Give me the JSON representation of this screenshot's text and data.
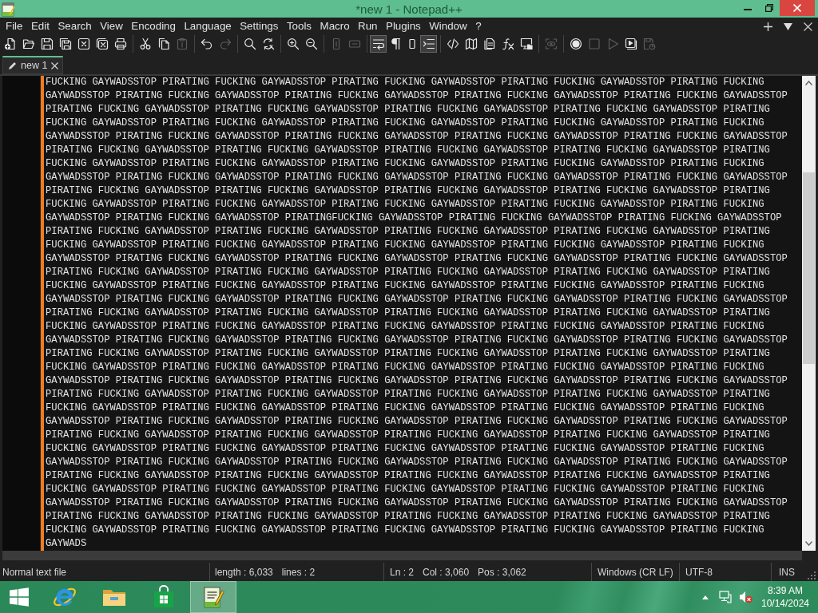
{
  "window": {
    "title": "*new 1 - Notepad++"
  },
  "menu": [
    "File",
    "Edit",
    "Search",
    "View",
    "Encoding",
    "Language",
    "Settings",
    "Tools",
    "Macro",
    "Run",
    "Plugins",
    "Window",
    "?"
  ],
  "toolbar": [
    [
      {
        "kind": "new",
        "disabled": false,
        "pressed": false
      },
      {
        "kind": "open",
        "disabled": false,
        "pressed": false
      },
      {
        "kind": "save",
        "disabled": false,
        "pressed": false
      },
      {
        "kind": "saveall",
        "disabled": false,
        "pressed": false
      },
      {
        "kind": "close",
        "disabled": false,
        "pressed": false
      },
      {
        "kind": "closeall",
        "disabled": false,
        "pressed": false
      },
      {
        "kind": "print",
        "disabled": false,
        "pressed": false
      }
    ],
    [
      {
        "kind": "cut",
        "disabled": false,
        "pressed": false
      },
      {
        "kind": "copy",
        "disabled": false,
        "pressed": false
      },
      {
        "kind": "paste",
        "disabled": true,
        "pressed": false
      }
    ],
    [
      {
        "kind": "undo",
        "disabled": false,
        "pressed": false
      },
      {
        "kind": "redo",
        "disabled": true,
        "pressed": false
      }
    ],
    [
      {
        "kind": "find",
        "disabled": false,
        "pressed": false
      },
      {
        "kind": "replace",
        "disabled": false,
        "pressed": false
      }
    ],
    [
      {
        "kind": "zoomin",
        "disabled": false,
        "pressed": false
      },
      {
        "kind": "zoomout",
        "disabled": false,
        "pressed": false
      }
    ],
    [
      {
        "kind": "syncv",
        "disabled": true,
        "pressed": false
      },
      {
        "kind": "synch",
        "disabled": true,
        "pressed": false
      }
    ],
    [
      {
        "kind": "wrap",
        "disabled": false,
        "pressed": true
      },
      {
        "kind": "allchars",
        "disabled": false,
        "pressed": false
      },
      {
        "kind": "panel",
        "disabled": false,
        "pressed": false
      },
      {
        "kind": "indentguide",
        "disabled": false,
        "pressed": true
      }
    ],
    [
      {
        "kind": "udl",
        "disabled": false,
        "pressed": false
      },
      {
        "kind": "docmap",
        "disabled": false,
        "pressed": false
      },
      {
        "kind": "doclist",
        "disabled": false,
        "pressed": false
      },
      {
        "kind": "funclist",
        "disabled": false,
        "pressed": false
      },
      {
        "kind": "folderws",
        "disabled": false,
        "pressed": false
      }
    ],
    [
      {
        "kind": "monitor",
        "disabled": true,
        "pressed": false
      }
    ],
    [
      {
        "kind": "record",
        "disabled": false,
        "pressed": false
      },
      {
        "kind": "stop",
        "disabled": true,
        "pressed": false
      },
      {
        "kind": "play",
        "disabled": true,
        "pressed": false
      },
      {
        "kind": "playmulti",
        "disabled": false,
        "pressed": false
      },
      {
        "kind": "savemacro",
        "disabled": true,
        "pressed": false
      }
    ]
  ],
  "tabs": [
    {
      "label": "new 1",
      "selected": true
    }
  ],
  "editor": {
    "modified": true,
    "lines": [
      "FUCKING GAYWADSSTOP PIRATING FUCKING GAYWADSSTOP PIRATING FUCKING GAYWADSSTOP PIRATING FUCKING GAYWADSSTOP PIRATING FUCKING",
      "GAYWADSSTOP PIRATING FUCKING GAYWADSSTOP PIRATING FUCKING GAYWADSSTOP PIRATING FUCKING GAYWADSSTOP PIRATING FUCKING GAYWADSSTOP",
      "PIRATING FUCKING GAYWADSSTOP PIRATING FUCKING GAYWADSSTOP PIRATING FUCKING GAYWADSSTOP PIRATING FUCKING GAYWADSSTOP PIRATING",
      "FUCKING GAYWADSSTOP PIRATING FUCKING GAYWADSSTOP PIRATING FUCKING GAYWADSSTOP PIRATING FUCKING GAYWADSSTOP PIRATING FUCKING",
      "GAYWADSSTOP PIRATING FUCKING GAYWADSSTOP PIRATING FUCKING GAYWADSSTOP PIRATING FUCKING GAYWADSSTOP PIRATING FUCKING GAYWADSSTOP",
      "PIRATING FUCKING GAYWADSSTOP PIRATING FUCKING GAYWADSSTOP PIRATING FUCKING GAYWADSSTOP PIRATING FUCKING GAYWADSSTOP PIRATING",
      "FUCKING GAYWADSSTOP PIRATING FUCKING GAYWADSSTOP PIRATING FUCKING GAYWADSSTOP PIRATING FUCKING GAYWADSSTOP PIRATING FUCKING",
      "GAYWADSSTOP PIRATING FUCKING GAYWADSSTOP PIRATING FUCKING GAYWADSSTOP PIRATING FUCKING GAYWADSSTOP PIRATING FUCKING GAYWADSSTOP",
      "PIRATING FUCKING GAYWADSSTOP PIRATING FUCKING GAYWADSSTOP PIRATING FUCKING GAYWADSSTOP PIRATING FUCKING GAYWADSSTOP PIRATING",
      "FUCKING GAYWADSSTOP PIRATING FUCKING GAYWADSSTOP PIRATING FUCKING GAYWADSSTOP PIRATING FUCKING GAYWADSSTOP PIRATING FUCKING",
      "GAYWADSSTOP PIRATING FUCKING GAYWADSSTOP PIRATINGFUCKING GAYWADSSTOP PIRATING FUCKING GAYWADSSTOP PIRATING FUCKING GAYWADSSTOP",
      "PIRATING FUCKING GAYWADSSTOP PIRATING FUCKING GAYWADSSTOP PIRATING FUCKING GAYWADSSTOP PIRATING FUCKING GAYWADSSTOP PIRATING",
      "FUCKING GAYWADSSTOP PIRATING FUCKING GAYWADSSTOP PIRATING FUCKING GAYWADSSTOP PIRATING FUCKING GAYWADSSTOP PIRATING FUCKING",
      "GAYWADSSTOP PIRATING FUCKING GAYWADSSTOP PIRATING FUCKING GAYWADSSTOP PIRATING FUCKING GAYWADSSTOP PIRATING FUCKING GAYWADSSTOP",
      "PIRATING FUCKING GAYWADSSTOP PIRATING FUCKING GAYWADSSTOP PIRATING FUCKING GAYWADSSTOP PIRATING FUCKING GAYWADSSTOP PIRATING",
      "FUCKING GAYWADSSTOP PIRATING FUCKING GAYWADSSTOP PIRATING FUCKING GAYWADSSTOP PIRATING FUCKING GAYWADSSTOP PIRATING FUCKING",
      "GAYWADSSTOP PIRATING FUCKING GAYWADSSTOP PIRATING FUCKING GAYWADSSTOP PIRATING FUCKING GAYWADSSTOP PIRATING FUCKING GAYWADSSTOP",
      "PIRATING FUCKING GAYWADSSTOP PIRATING FUCKING GAYWADSSTOP PIRATING FUCKING GAYWADSSTOP PIRATING FUCKING GAYWADSSTOP PIRATING",
      "FUCKING GAYWADSSTOP PIRATING FUCKING GAYWADSSTOP PIRATING FUCKING GAYWADSSTOP PIRATING FUCKING GAYWADSSTOP PIRATING FUCKING",
      "GAYWADSSTOP PIRATING FUCKING GAYWADSSTOP PIRATING FUCKING GAYWADSSTOP PIRATING FUCKING GAYWADSSTOP PIRATING FUCKING GAYWADSSTOP",
      "PIRATING FUCKING GAYWADSSTOP PIRATING FUCKING GAYWADSSTOP PIRATING FUCKING GAYWADSSTOP PIRATING FUCKING GAYWADSSTOP PIRATING",
      "FUCKING GAYWADSSTOP PIRATING FUCKING GAYWADSSTOP PIRATING FUCKING GAYWADSSTOP PIRATING FUCKING GAYWADSSTOP PIRATING FUCKING",
      "GAYWADSSTOP PIRATING FUCKING GAYWADSSTOP PIRATING FUCKING GAYWADSSTOP PIRATING FUCKING GAYWADSSTOP PIRATING FUCKING GAYWADSSTOP",
      "PIRATING FUCKING GAYWADSSTOP PIRATING FUCKING GAYWADSSTOP PIRATING FUCKING GAYWADSSTOP PIRATING FUCKING GAYWADSSTOP PIRATING",
      "FUCKING GAYWADSSTOP PIRATING FUCKING GAYWADSSTOP PIRATING FUCKING GAYWADSSTOP PIRATING FUCKING GAYWADSSTOP PIRATING FUCKING",
      "GAYWADSSTOP PIRATING FUCKING GAYWADSSTOP PIRATING FUCKING GAYWADSSTOP PIRATING FUCKING GAYWADSSTOP PIRATING FUCKING GAYWADSSTOP",
      "PIRATING FUCKING GAYWADSSTOP PIRATING FUCKING GAYWADSSTOP PIRATING FUCKING GAYWADSSTOP PIRATING FUCKING GAYWADSSTOP PIRATING",
      "FUCKING GAYWADSSTOP PIRATING FUCKING GAYWADSSTOP PIRATING FUCKING GAYWADSSTOP PIRATING FUCKING GAYWADSSTOP PIRATING FUCKING",
      "GAYWADSSTOP PIRATING FUCKING GAYWADSSTOP PIRATING FUCKING GAYWADSSTOP PIRATING FUCKING GAYWADSSTOP PIRATING FUCKING GAYWADSSTOP",
      "PIRATING FUCKING GAYWADSSTOP PIRATING FUCKING GAYWADSSTOP PIRATING FUCKING GAYWADSSTOP PIRATING FUCKING GAYWADSSTOP PIRATING",
      "FUCKING GAYWADSSTOP PIRATING FUCKING GAYWADSSTOP PIRATING FUCKING GAYWADSSTOP PIRATING FUCKING GAYWADSSTOP PIRATING FUCKING",
      "GAYWADSSTOP PIRATING FUCKING GAYWADSSTOP PIRATING FUCKING GAYWADSSTOP PIRATING FUCKING GAYWADSSTOP PIRATING FUCKING GAYWADSSTOP",
      "PIRATING FUCKING GAYWADSSTOP PIRATING FUCKING GAYWADSSTOP PIRATING FUCKING GAYWADSSTOP PIRATING FUCKING GAYWADSSTOP PIRATING",
      "FUCKING GAYWADSSTOP PIRATING FUCKING GAYWADSSTOP PIRATING FUCKING GAYWADSSTOP PIRATING FUCKING GAYWADSSTOP PIRATING FUCKING",
      "GAYWADS"
    ]
  },
  "status_bar": [
    [
      "Normal text file"
    ],
    [
      "length : 6,033",
      "lines : 2"
    ],
    [
      "Ln : 2",
      "Col : 3,060",
      "Pos : 3,062"
    ],
    [
      "Windows (CR LF)"
    ],
    [
      "UTF-8"
    ],
    [
      "INS"
    ]
  ],
  "taskbar": {
    "apps": [
      {
        "kind": "browser",
        "selected": false
      },
      {
        "kind": "explorer",
        "selected": false
      },
      {
        "kind": "store",
        "selected": false
      },
      {
        "kind": "notepad",
        "selected": true
      }
    ],
    "sound_muted": true,
    "time": "8:39 AM",
    "date": "10/14/2024"
  }
}
